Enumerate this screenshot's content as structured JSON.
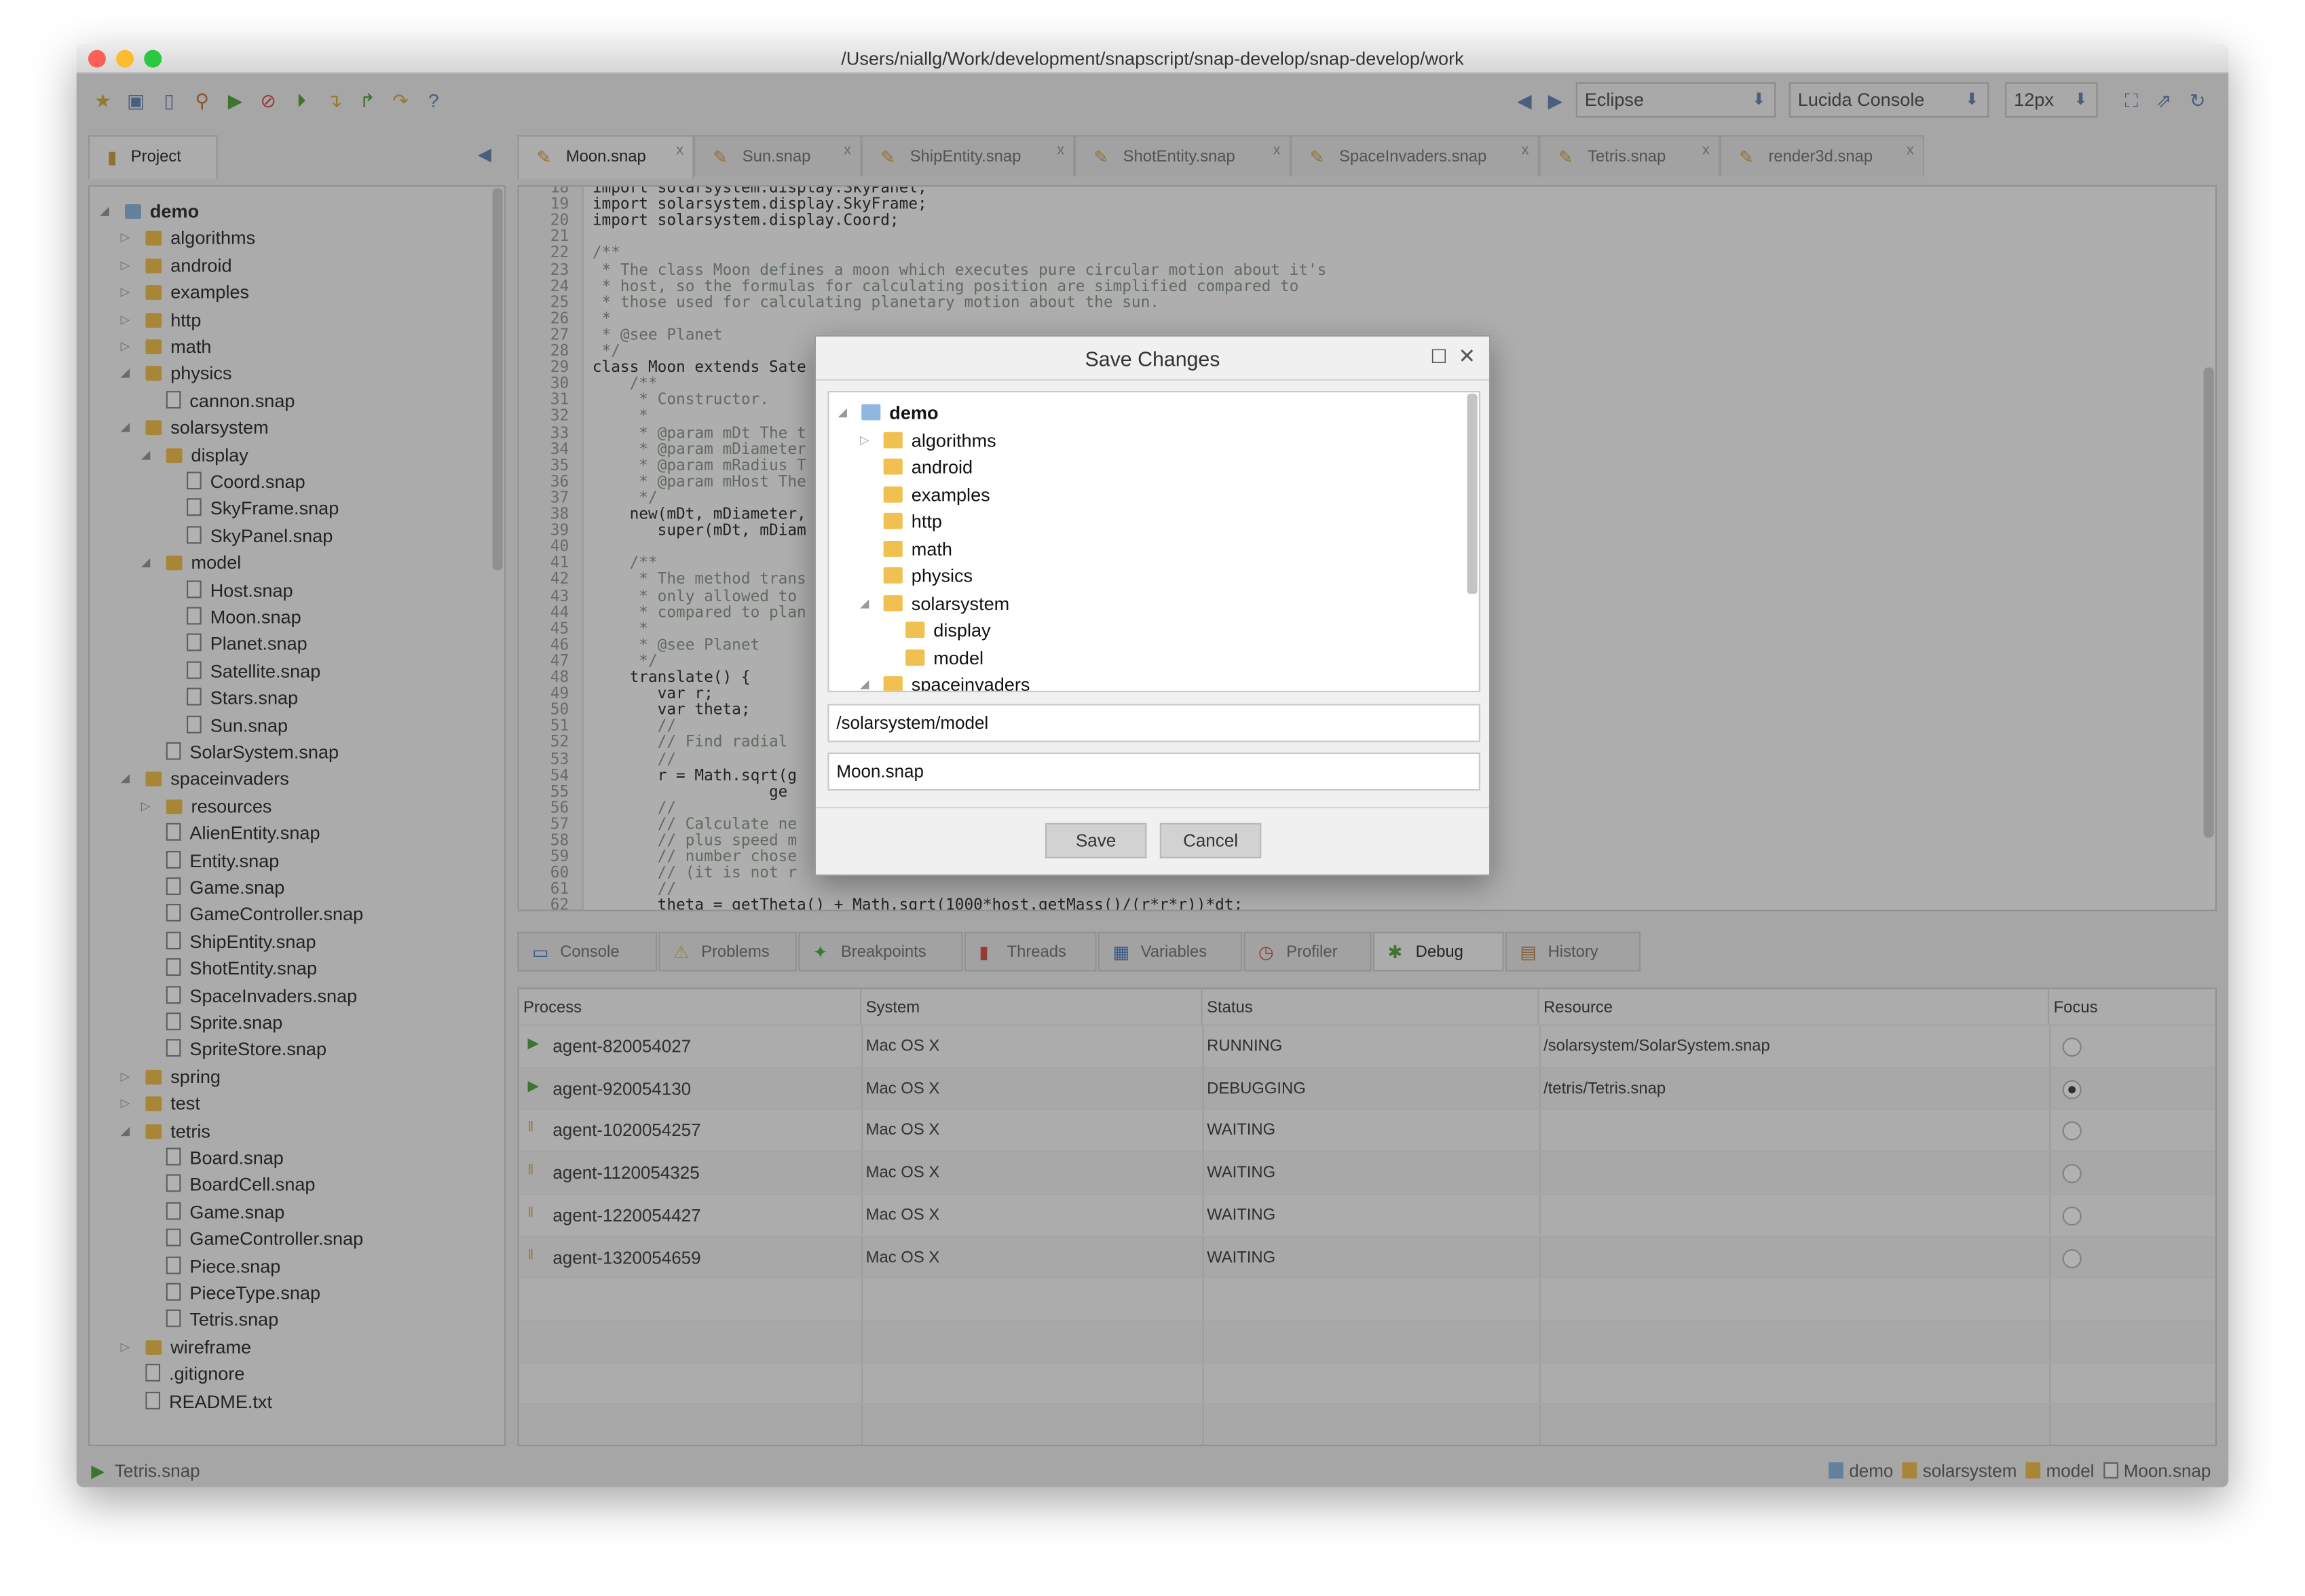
{
  "window": {
    "title": "/Users/niallg/Work/development/snapscript/snap-develop/snap-develop/work"
  },
  "toolbar": {
    "icons": [
      "new-icon",
      "save-icon",
      "delete-icon",
      "search-icon",
      "run-icon",
      "stop-icon",
      "resume-icon",
      "step-in-icon",
      "step-out-icon",
      "step-over-icon",
      "help-icon"
    ],
    "theme": "Eclipse",
    "font": "Lucida Console",
    "font_size": "12px"
  },
  "project_panel": {
    "label": "Project"
  },
  "editor_tabs": [
    "Moon.snap",
    "Sun.snap",
    "ShipEntity.snap",
    "ShotEntity.snap",
    "SpaceInvaders.snap",
    "Tetris.snap",
    "render3d.snap"
  ],
  "project_tree": [
    [
      "demo",
      0,
      "root",
      "open"
    ],
    [
      "algorithms",
      1,
      "folder",
      "closed"
    ],
    [
      "android",
      1,
      "folder",
      "closed"
    ],
    [
      "examples",
      1,
      "folder",
      "closed"
    ],
    [
      "http",
      1,
      "folder",
      "closed"
    ],
    [
      "math",
      1,
      "folder",
      "closed"
    ],
    [
      "physics",
      1,
      "folder",
      "open"
    ],
    [
      "cannon.snap",
      2,
      "file",
      ""
    ],
    [
      "solarsystem",
      1,
      "folder",
      "open"
    ],
    [
      "display",
      2,
      "folder",
      "open"
    ],
    [
      "Coord.snap",
      3,
      "file",
      ""
    ],
    [
      "SkyFrame.snap",
      3,
      "file",
      ""
    ],
    [
      "SkyPanel.snap",
      3,
      "file",
      ""
    ],
    [
      "model",
      2,
      "folder",
      "open"
    ],
    [
      "Host.snap",
      3,
      "file",
      ""
    ],
    [
      "Moon.snap",
      3,
      "file",
      ""
    ],
    [
      "Planet.snap",
      3,
      "file",
      ""
    ],
    [
      "Satellite.snap",
      3,
      "file",
      ""
    ],
    [
      "Stars.snap",
      3,
      "file",
      ""
    ],
    [
      "Sun.snap",
      3,
      "file",
      ""
    ],
    [
      "SolarSystem.snap",
      2,
      "file",
      ""
    ],
    [
      "spaceinvaders",
      1,
      "folder",
      "open"
    ],
    [
      "resources",
      2,
      "folder",
      "closed"
    ],
    [
      "AlienEntity.snap",
      2,
      "file",
      ""
    ],
    [
      "Entity.snap",
      2,
      "file",
      ""
    ],
    [
      "Game.snap",
      2,
      "file",
      ""
    ],
    [
      "GameController.snap",
      2,
      "file",
      ""
    ],
    [
      "ShipEntity.snap",
      2,
      "file",
      ""
    ],
    [
      "ShotEntity.snap",
      2,
      "file",
      ""
    ],
    [
      "SpaceInvaders.snap",
      2,
      "file",
      ""
    ],
    [
      "Sprite.snap",
      2,
      "file",
      ""
    ],
    [
      "SpriteStore.snap",
      2,
      "file",
      ""
    ],
    [
      "spring",
      1,
      "folder",
      "closed"
    ],
    [
      "test",
      1,
      "folder",
      "closed"
    ],
    [
      "tetris",
      1,
      "folder",
      "open"
    ],
    [
      "Board.snap",
      2,
      "file",
      ""
    ],
    [
      "BoardCell.snap",
      2,
      "file",
      ""
    ],
    [
      "Game.snap",
      2,
      "file",
      ""
    ],
    [
      "GameController.snap",
      2,
      "file",
      ""
    ],
    [
      "Piece.snap",
      2,
      "file",
      ""
    ],
    [
      "PieceType.snap",
      2,
      "file",
      ""
    ],
    [
      "Tetris.snap",
      2,
      "file",
      ""
    ],
    [
      "wireframe",
      1,
      "folder",
      "closed"
    ],
    [
      ".gitignore",
      1,
      "file",
      ""
    ],
    [
      "README.txt",
      1,
      "file",
      ""
    ]
  ],
  "code": {
    "first_line": 18,
    "lines": [
      "import solarsystem.display.SkyPanel;",
      "import solarsystem.display.SkyFrame;",
      "import solarsystem.display.Coord;",
      "",
      "/**",
      " * The class Moon defines a moon which executes pure circular motion about it's",
      " * host, so the formulas for calculating position are simplified compared to",
      " * those used for calculating planetary motion about the sun.",
      " *",
      " * @see Planet",
      " */",
      "class Moon extends Sate",
      "    /**",
      "     * Constructor.",
      "     *",
      "     * @param mDt The t",
      "     * @param mDiameter",
      "     * @param mRadius T",
      "     * @param mHost The",
      "     */",
      "    new(mDt, mDiameter,",
      "       super(mDt, mDiam",
      "",
      "    /**",
      "     * The method trans",
      "     * only allowed to",
      "     * compared to plan",
      "     *",
      "     * @see Planet",
      "     */",
      "    translate() {",
      "       var r;",
      "       var theta;",
      "       //",
      "       // Find radial",
      "       //",
      "       r = Math.sqrt(g",
      "                   ge",
      "       //",
      "       // Calculate ne",
      "       // plus speed m",
      "       // number chose",
      "       // (it is not r",
      "       //",
      "       theta = getTheta() + Math.sqrt(1000*host.getMass()/(r*r*r))*dt;"
    ]
  },
  "bottom_tabs": [
    [
      "Console",
      "#4a7fc1"
    ],
    [
      "Problems",
      "#e8c030"
    ],
    [
      "Breakpoints",
      "#4caf50"
    ],
    [
      "Threads",
      "#d9534f"
    ],
    [
      "Variables",
      "#4a7fc1"
    ],
    [
      "Profiler",
      "#d9534f"
    ],
    [
      "Debug",
      "#5aa545"
    ],
    [
      "History",
      "#c08040"
    ]
  ],
  "debug_table": {
    "columns": [
      "Process",
      "System",
      "Status",
      "Resource",
      "Focus"
    ],
    "rows": [
      {
        "process": "agent-820054027",
        "system": "Mac OS X",
        "status": "RUNNING",
        "resource": "/solarsystem/SolarSystem.snap",
        "focus": false,
        "state": "running"
      },
      {
        "process": "agent-920054130",
        "system": "Mac OS X",
        "status": "DEBUGGING",
        "resource": "/tetris/Tetris.snap",
        "focus": true,
        "state": "debugging"
      },
      {
        "process": "agent-1020054257",
        "system": "Mac OS X",
        "status": "WAITING",
        "resource": "",
        "focus": false,
        "state": "waiting"
      },
      {
        "process": "agent-1120054325",
        "system": "Mac OS X",
        "status": "WAITING",
        "resource": "",
        "focus": false,
        "state": "waiting"
      },
      {
        "process": "agent-1220054427",
        "system": "Mac OS X",
        "status": "WAITING",
        "resource": "",
        "focus": false,
        "state": "waiting"
      },
      {
        "process": "agent-1320054659",
        "system": "Mac OS X",
        "status": "WAITING",
        "resource": "",
        "focus": false,
        "state": "waiting"
      }
    ]
  },
  "statusbar": {
    "left": "Tetris.snap",
    "breadcrumb": [
      "demo",
      "solarsystem",
      "model",
      "Moon.snap"
    ]
  },
  "dialog": {
    "title": "Save Changes",
    "tree": [
      [
        "demo",
        0,
        "root",
        "open"
      ],
      [
        "algorithms",
        1,
        "folder",
        "closed"
      ],
      [
        "android",
        1,
        "folder",
        ""
      ],
      [
        "examples",
        1,
        "folder",
        ""
      ],
      [
        "http",
        1,
        "folder",
        ""
      ],
      [
        "math",
        1,
        "folder",
        ""
      ],
      [
        "physics",
        1,
        "folder",
        ""
      ],
      [
        "solarsystem",
        1,
        "folder",
        "open"
      ],
      [
        "display",
        2,
        "folder",
        ""
      ],
      [
        "model",
        2,
        "folder",
        ""
      ],
      [
        "spaceinvaders",
        1,
        "folder",
        "open"
      ]
    ],
    "path": "/solarsystem/model",
    "filename": "Moon.snap",
    "save_label": "Save",
    "cancel_label": "Cancel"
  },
  "colors": {
    "accent_folder": "#f0c050",
    "running": "#5aa545",
    "waiting": "#d9b060"
  }
}
